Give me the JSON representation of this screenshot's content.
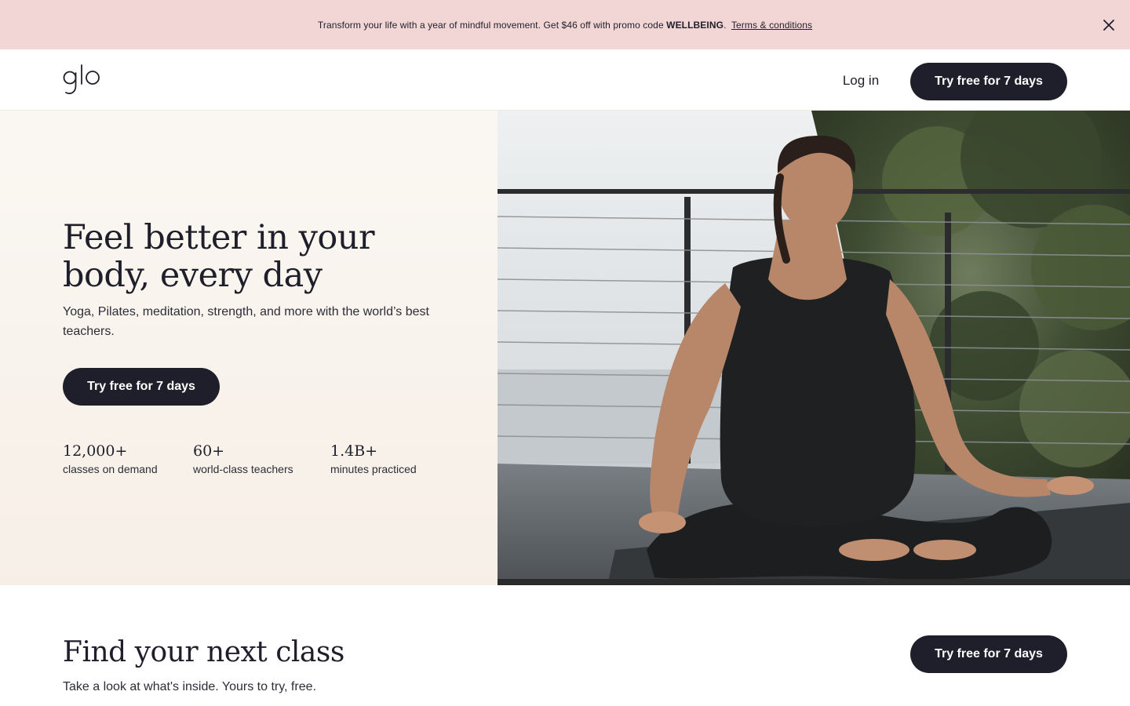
{
  "promo": {
    "text": "Transform your life with a year of mindful movement. Get $46 off with promo code ",
    "code": "WELLBEING",
    "period": ".",
    "terms_link": "Terms & conditions",
    "close_icon": "close-icon"
  },
  "header": {
    "logo": "glo",
    "login_label": "Log in",
    "cta_label": "Try free for 7 days"
  },
  "hero": {
    "title": "Feel better in your body, every day",
    "subtitle": "Yoga, Pilates, meditation, strength, and more with the world’s best teachers.",
    "cta_label": "Try free for 7 days",
    "stats": [
      {
        "value": "12,000+",
        "label": "classes on demand"
      },
      {
        "value": "60+",
        "label": "world-class teachers"
      },
      {
        "value": "1.4B+",
        "label": "minutes practiced"
      }
    ]
  },
  "find": {
    "title": "Find your next class",
    "subtitle": "Take a look at what's inside. Yours to try, free.",
    "cta_label": "Try free for 7 days"
  },
  "colors": {
    "promo_bg": "#f2d6d6",
    "dark_button": "#1f1f2b",
    "hero_left_bg": "#faf7f2"
  }
}
